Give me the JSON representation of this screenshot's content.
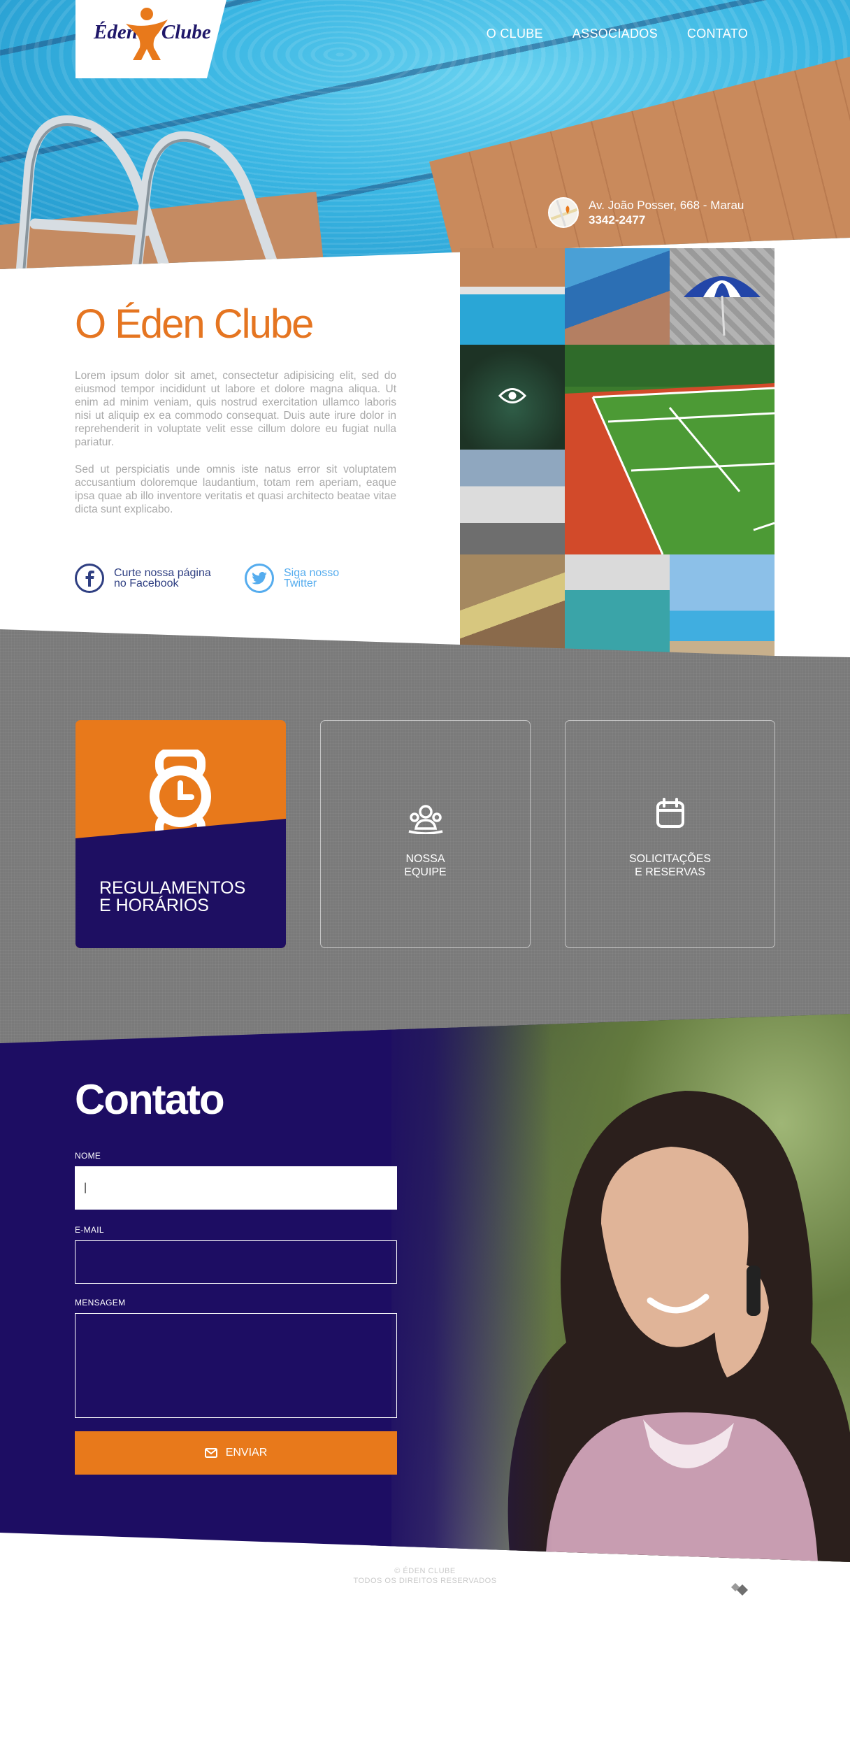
{
  "brand": {
    "name_left": "Éden",
    "name_right": "Clube"
  },
  "nav": {
    "items": [
      "O CLUBE",
      "ASSOCIADOS",
      "CONTATO"
    ]
  },
  "address": {
    "street": "Av. João Posser, 668 - Marau",
    "phone": "3342-2477"
  },
  "about": {
    "title": "O Éden Clube",
    "paragraph1": "Lorem ipsum dolor sit amet, consectetur adipisicing elit, sed do eiusmod tempor incididunt ut labore et dolore magna aliqua. Ut enim ad minim veniam, quis nostrud exercitation ullamco laboris nisi ut aliquip ex ea commodo consequat. Duis aute irure dolor in reprehenderit in voluptate velit esse cillum dolore eu fugiat nulla pariatur.",
    "paragraph2": "Sed ut perspiciatis unde omnis iste natus error sit voluptatem accusantium doloremque laudantium, totam rem aperiam, eaque ipsa quae ab illo inventore veritatis et quasi architecto beatae vitae dicta sunt explicabo.",
    "facebook_line1": "Curte nossa página",
    "facebook_line2": "no Facebook",
    "twitter_line1": "Siga nosso",
    "twitter_line2": "Twitter"
  },
  "services": {
    "card1_line1": "REGULAMENTOS",
    "card1_line2": "E HORÁRIOS",
    "card2_line1": "NOSSA",
    "card2_line2": "EQUIPE",
    "card3_line1": "SOLICITAÇÕES",
    "card3_line2": "E RESERVAS"
  },
  "contact": {
    "title": "Contato",
    "name_label": "NOME",
    "name_value": "|",
    "email_label": "E-MAIL",
    "message_label": "MENSAGEM",
    "send_label": "ENVIAR"
  },
  "footer": {
    "line1": "© ÉDEN CLUBE",
    "line2": "TODOS OS DIREITOS RESERVADOS"
  },
  "colors": {
    "orange": "#e8791b",
    "navy": "#1e0f62",
    "gray": "#7a7a7a",
    "facebook": "#3b5998",
    "twitter": "#55acee"
  },
  "icons": [
    "map-pin-icon",
    "facebook-icon",
    "twitter-icon",
    "eye-icon",
    "clock-icon",
    "team-icon",
    "calendar-icon",
    "mail-icon",
    "footer-logo-icon"
  ]
}
